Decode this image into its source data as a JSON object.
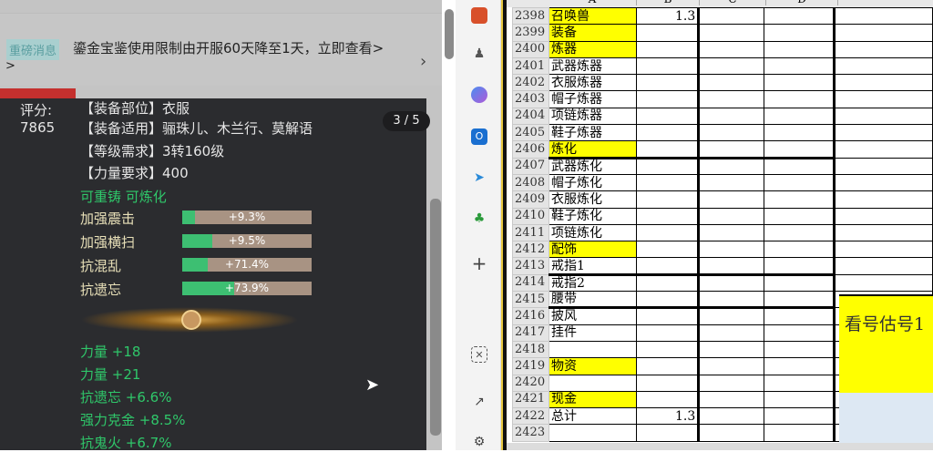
{
  "notice": {
    "tag": "重磅消息",
    "message": "鎏金宝鉴使用限制由开服60天降至1天，立即查看>",
    "tail": ">",
    "chevron": "›"
  },
  "item": {
    "score_label": "评分:",
    "score": "7865",
    "pager": "3 / 5",
    "lines": [
      "【装备部位】衣服",
      "【装备适用】骊珠儿、木兰行、莫解语",
      "【等级需求】3转160级",
      "【力量要求】400"
    ],
    "flags": "可重铸 可炼化",
    "bars": [
      {
        "name": "加强震击",
        "value": "+9.3%",
        "fill": 0.1
      },
      {
        "name": "加强横扫",
        "value": "+9.5%",
        "fill": 0.23
      },
      {
        "name": "抗混乱",
        "value": "+71.4%",
        "fill": 0.2
      },
      {
        "name": "抗遗忘",
        "value": "+73.9%",
        "fill": 0.4
      }
    ],
    "stats": [
      "力量 +18",
      "力量 +21",
      "抗遗忘 +6.6%",
      "强力克金 +8.5%",
      "抗鬼火 +6.7%"
    ]
  },
  "sidebar": {
    "icons": [
      "toolbox-icon",
      "chess-icon",
      "copilot-icon",
      "outlook-icon",
      "telegram-icon",
      "tree-icon",
      "add-icon",
      "screenshot-icon",
      "external-link-icon",
      "settings-icon"
    ]
  },
  "sheet": {
    "columns": [
      "A",
      "B",
      "C",
      "D"
    ],
    "rows": [
      {
        "n": "2398",
        "a": "召唤兽",
        "b": "1.3",
        "hl": true
      },
      {
        "n": "2399",
        "a": "装备",
        "b": "",
        "hl": true
      },
      {
        "n": "2400",
        "a": "炼器",
        "b": "",
        "hl": true
      },
      {
        "n": "2401",
        "a": "武器炼器",
        "b": ""
      },
      {
        "n": "2402",
        "a": "衣服炼器",
        "b": ""
      },
      {
        "n": "2403",
        "a": "帽子炼器",
        "b": ""
      },
      {
        "n": "2404",
        "a": "项链炼器",
        "b": ""
      },
      {
        "n": "2405",
        "a": "鞋子炼器",
        "b": ""
      },
      {
        "n": "2406",
        "a": "炼化",
        "b": "",
        "hl": true
      },
      {
        "n": "2407",
        "a": "武器炼化",
        "b": ""
      },
      {
        "n": "2408",
        "a": "帽子炼化",
        "b": ""
      },
      {
        "n": "2409",
        "a": "衣服炼化",
        "b": ""
      },
      {
        "n": "2410",
        "a": "鞋子炼化",
        "b": ""
      },
      {
        "n": "2411",
        "a": "项链炼化",
        "b": ""
      },
      {
        "n": "2412",
        "a": "配饰",
        "b": "",
        "hl": true
      },
      {
        "n": "2413",
        "a": "戒指1",
        "b": ""
      },
      {
        "n": "2414",
        "a": "戒指2",
        "b": ""
      },
      {
        "n": "2415",
        "a": "腰带",
        "b": ""
      },
      {
        "n": "2416",
        "a": "披风",
        "b": ""
      },
      {
        "n": "2417",
        "a": "挂件",
        "b": ""
      },
      {
        "n": "2418",
        "a": "",
        "b": ""
      },
      {
        "n": "2419",
        "a": "物资",
        "b": "",
        "hl": true
      },
      {
        "n": "2420",
        "a": "",
        "b": ""
      },
      {
        "n": "2421",
        "a": "现金",
        "b": "",
        "hl": true
      },
      {
        "n": "2422",
        "a": "总计",
        "b": "1.3"
      },
      {
        "n": "2423",
        "a": "",
        "b": ""
      }
    ],
    "merged_text": "看号估号1"
  },
  "colors": {
    "highlight": "#ffff00",
    "green": "#3dbf72",
    "panel": "#2b2c2f"
  }
}
